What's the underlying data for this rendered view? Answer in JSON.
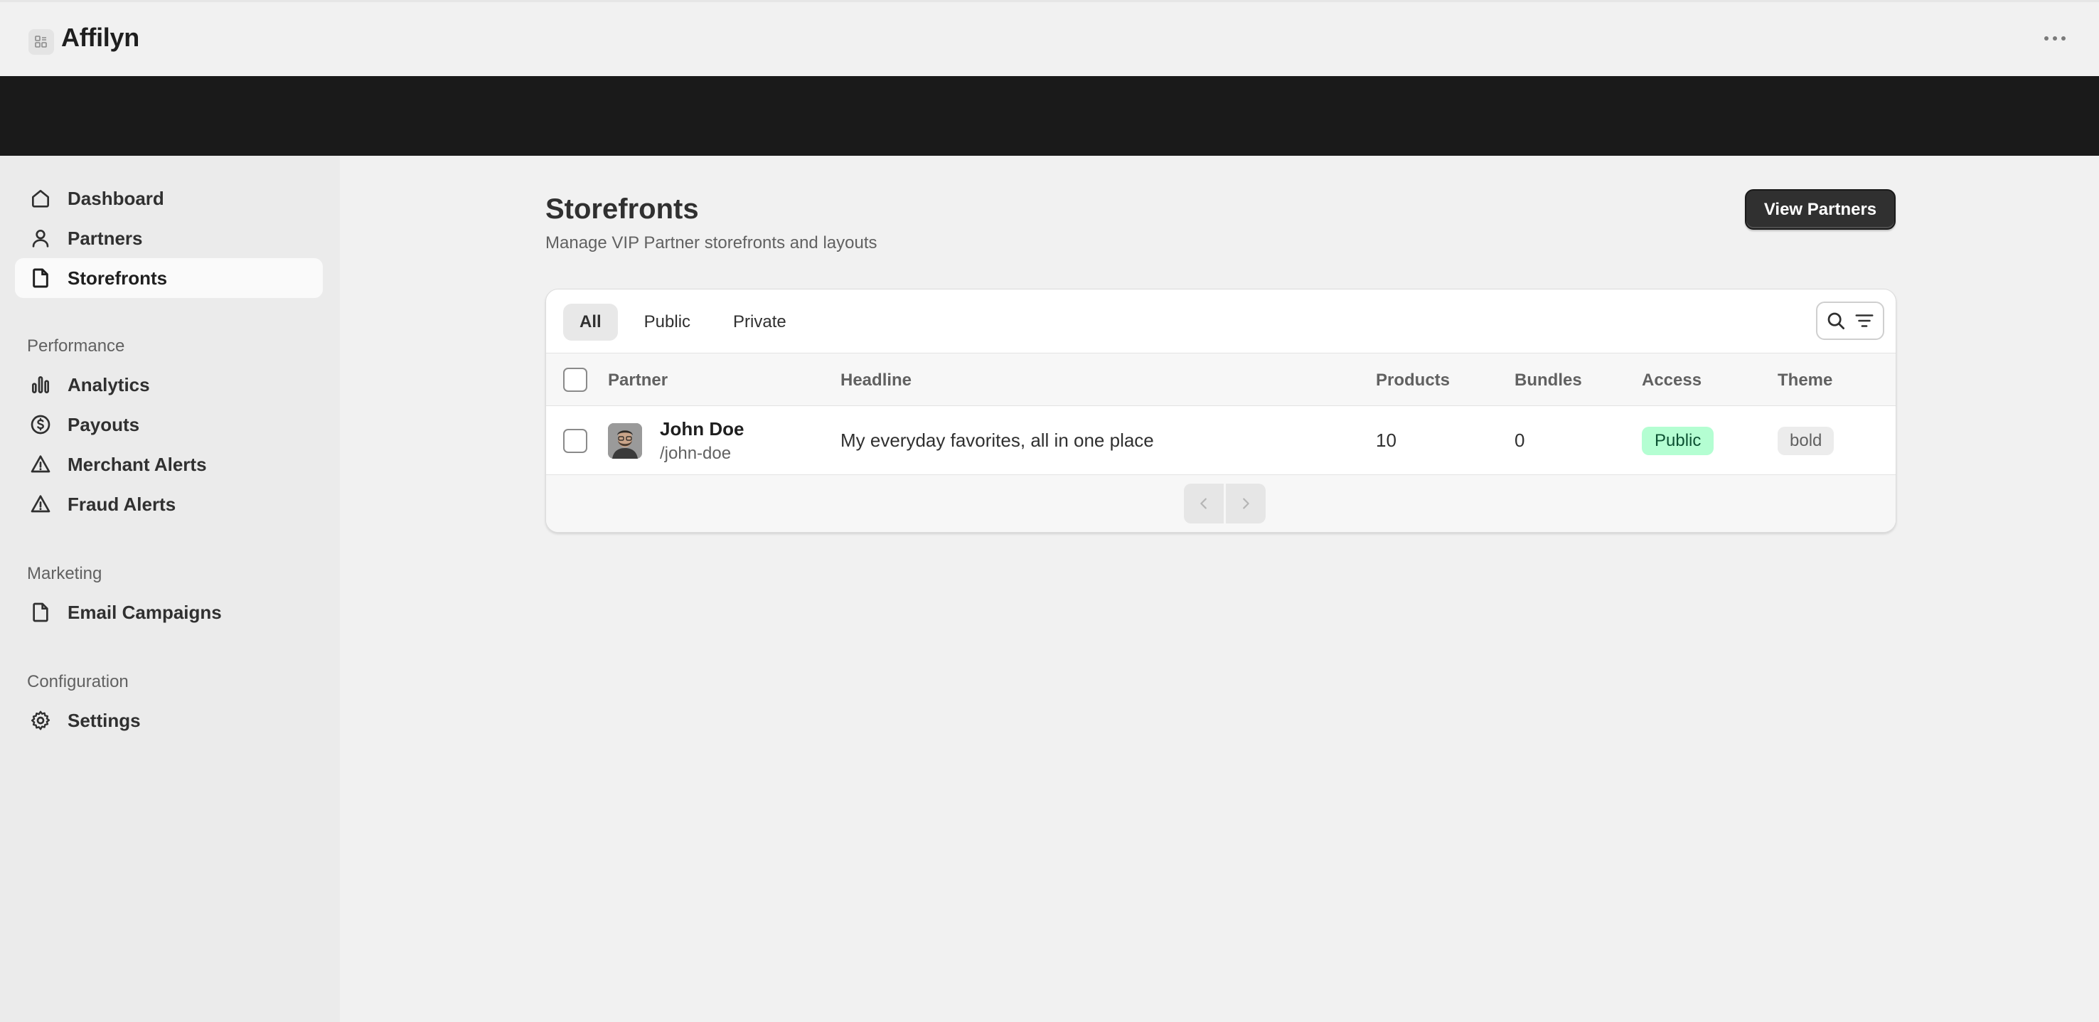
{
  "app": {
    "title": "Affilyn"
  },
  "sidebar": {
    "items": [
      {
        "label": "Dashboard",
        "icon": "home-icon"
      },
      {
        "label": "Partners",
        "icon": "person-icon"
      },
      {
        "label": "Storefronts",
        "icon": "file-icon",
        "active": true
      }
    ],
    "sections": [
      {
        "title": "Performance",
        "items": [
          {
            "label": "Analytics",
            "icon": "bar-chart-icon"
          },
          {
            "label": "Payouts",
            "icon": "dollar-circle-icon"
          },
          {
            "label": "Merchant Alerts",
            "icon": "alert-triangle-icon"
          },
          {
            "label": "Fraud Alerts",
            "icon": "alert-triangle-icon"
          }
        ]
      },
      {
        "title": "Marketing",
        "items": [
          {
            "label": "Email Campaigns",
            "icon": "file-icon"
          }
        ]
      },
      {
        "title": "Configuration",
        "items": [
          {
            "label": "Settings",
            "icon": "gear-icon"
          }
        ]
      }
    ]
  },
  "page": {
    "title": "Storefronts",
    "subtitle": "Manage VIP Partner storefronts and layouts",
    "primary_action": "View Partners"
  },
  "tabs": [
    {
      "label": "All",
      "active": true
    },
    {
      "label": "Public"
    },
    {
      "label": "Private"
    }
  ],
  "table": {
    "columns": [
      "Partner",
      "Headline",
      "Products",
      "Bundles",
      "Access",
      "Theme"
    ],
    "rows": [
      {
        "partner_name": "John Doe",
        "partner_slug": "/john-doe",
        "headline": "My everyday favorites, all in one place",
        "products": "10",
        "bundles": "0",
        "access": "Public",
        "theme": "bold"
      }
    ]
  },
  "colors": {
    "brand_dark": "#1a1a1a",
    "accent_public": "#b4fed2",
    "sidebar_bg": "#ebebeb"
  }
}
